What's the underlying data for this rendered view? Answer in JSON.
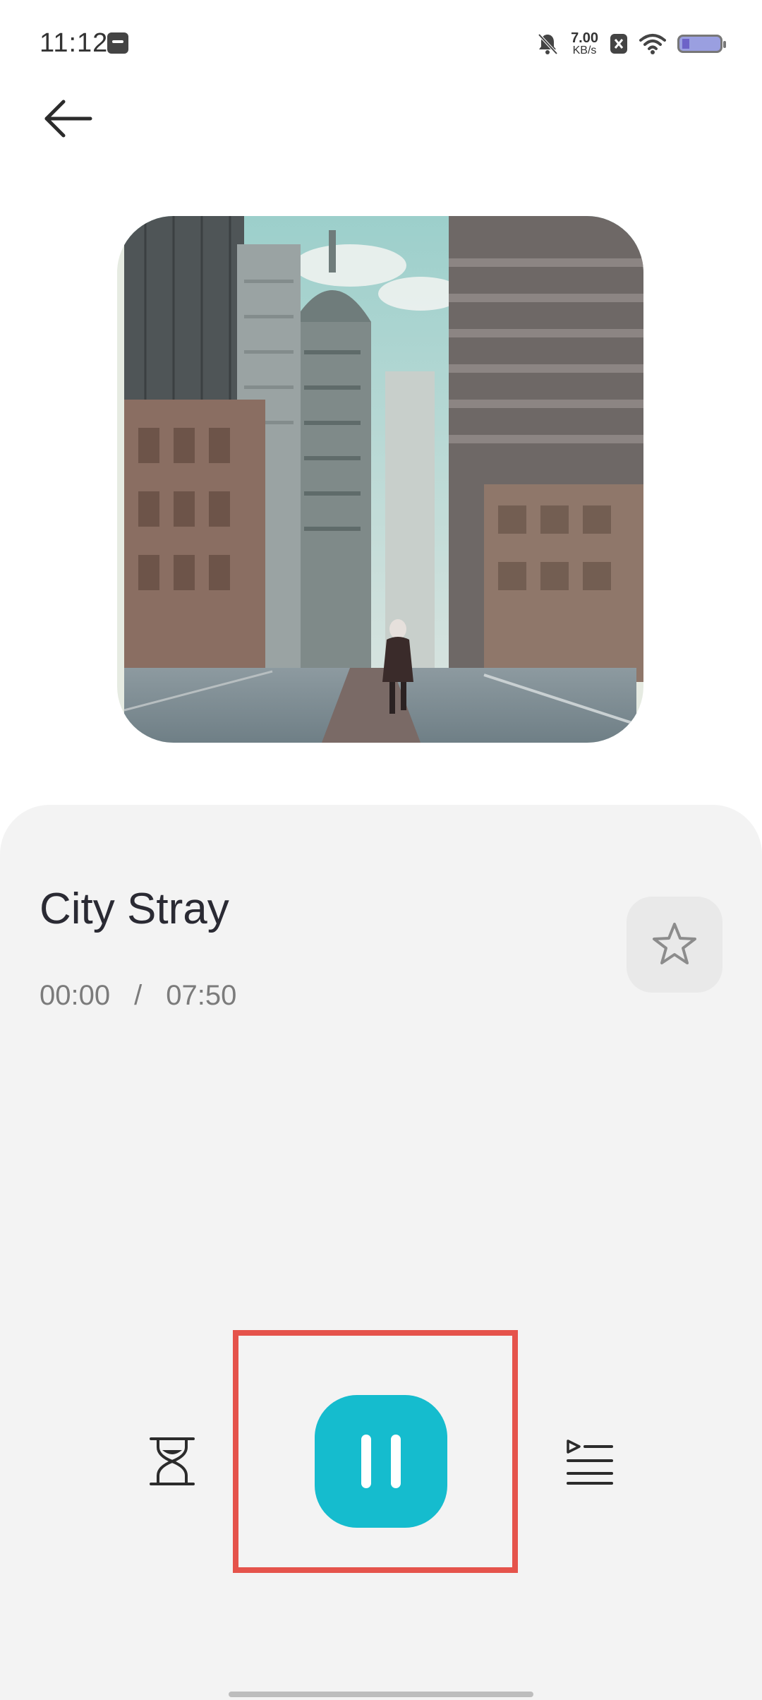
{
  "status_bar": {
    "time": "11:12",
    "network_speed_value": "7.00",
    "network_speed_unit": "KB/s",
    "icons": [
      "calendar-app-icon",
      "mute-bell-icon",
      "sim-off-icon",
      "wifi-icon",
      "battery-icon"
    ]
  },
  "navigation": {
    "back_icon": "arrow-left-icon"
  },
  "track": {
    "title": "City Stray",
    "current_time": "00:00",
    "separator": "/",
    "total_time": "07:50"
  },
  "controls": {
    "favorite_icon": "star-outline-icon",
    "timer_icon": "hourglass-icon",
    "play_pause_icon": "pause-icon",
    "queue_icon": "playlist-icon"
  },
  "colors": {
    "accent": "#15bcce",
    "highlight": "#e5534b",
    "panel": "#f3f3f3"
  }
}
